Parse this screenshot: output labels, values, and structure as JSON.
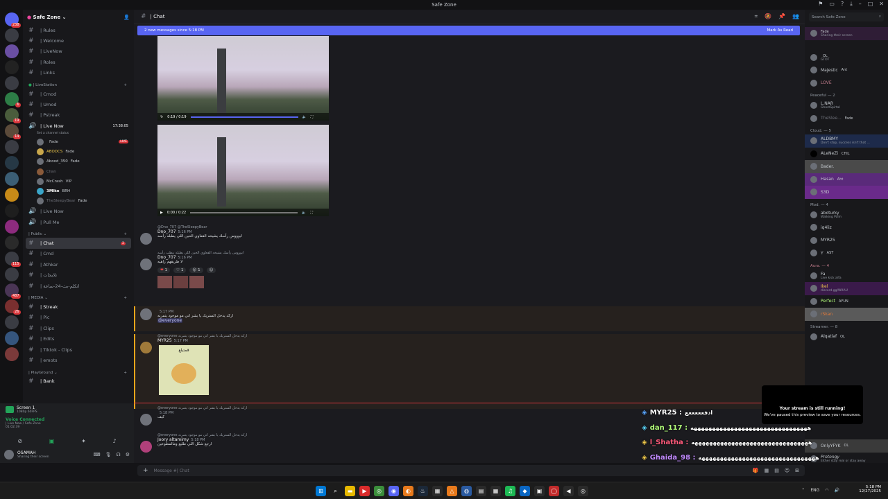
{
  "window": {
    "title": "Safe Zone"
  },
  "server": {
    "name": "Safe Zone"
  },
  "channels": {
    "top": [
      {
        "name": "| Rules"
      },
      {
        "name": "| Welcome"
      },
      {
        "name": "| LiveNow"
      },
      {
        "name": "| Roles"
      },
      {
        "name": "| Links"
      }
    ],
    "cat_live": "| LiveStation",
    "live_channels": [
      {
        "name": "| Cmod"
      },
      {
        "name": "| Umod"
      },
      {
        "name": "| Pstreak"
      }
    ],
    "voice_live": {
      "name": "| Live Now",
      "timer": "17:38:05",
      "status": "Set a channel status"
    },
    "voice_users": [
      {
        "name": "",
        "tag": "Fade",
        "live": "LIVE"
      },
      {
        "name": "ABODCS",
        "tag": "Fade"
      },
      {
        "name": "Abood_350",
        "tag": "Fade"
      },
      {
        "name": "Cllan",
        "tag": ""
      },
      {
        "name": "McCrash",
        "tag": "VIP"
      },
      {
        "name": "3Mlke",
        "tag": "BRH"
      },
      {
        "name": "TheSleepyBear",
        "tag": "Fade"
      }
    ],
    "voice_more": [
      {
        "name": "| Live Now"
      },
      {
        "name": "| Pull Me"
      }
    ],
    "cat_public": "| Public",
    "public": [
      {
        "name": "| Chat",
        "badge": "2"
      },
      {
        "name": "| Cmd"
      },
      {
        "name": "| Athkar"
      },
      {
        "name": "| تلايجات"
      },
      {
        "name": "| اتكلم-بث-24-ساعة"
      }
    ],
    "cat_media": "| MEDIA",
    "media": [
      {
        "name": "| Streak"
      },
      {
        "name": "| Pic"
      },
      {
        "name": "| Clips"
      },
      {
        "name": "| Edits"
      },
      {
        "name": "| Tiktok - Clips"
      },
      {
        "name": "| emots"
      }
    ],
    "cat_play": "| PlayGround",
    "play": [
      {
        "name": "| Bank"
      }
    ]
  },
  "userpanel": {
    "screen_title": "Screen 1",
    "screen_sub": "1080p 60FPS",
    "voice_title": "Voice Connected",
    "voice_sub": "| Live Now / Safe Zone",
    "voice_time": "01:02:39",
    "user_name": "OSAMAH",
    "user_status": "Sharing their screen"
  },
  "chat": {
    "channel": "| Chat",
    "banner": "2 new messages since 5:18 PM",
    "mark_read": "Mark As Read",
    "video1_time": "0:19 / 0:19",
    "video2_time": "0:00 / 0:22",
    "messages": [
      {
        "user": "Dno_707",
        "reply": "@Dno_707 @TheSleepyBear",
        "time": "5:16 PM",
        "text": "ابوووس رأسك يشيخه القعاوي الحين اللي يطبله رأسه"
      },
      {
        "user": "Dno_707",
        "time": "5:16 PM",
        "text": "لا طريقهم زاهيه",
        "reply": "ابوووس رأسك يشيخه القعاوي الحين اللي يطبله يبطب رأسه"
      },
      {
        "user": "",
        "time": "5:17 PM",
        "text": "اركد يدخل الستريك يا بشر اني مو موجود يتمرنه",
        "mention": "@everyone"
      },
      {
        "user": "MYR25",
        "time": "5:17 PM",
        "reply": "@everyone اركد يدخل الستريك يا بشر اني مو موجود يتمرنه",
        "sticker": "قمتبلع"
      },
      {
        "user": "",
        "time": "5:18 PM",
        "reply": "@everyone اركد يدخل الستريك يا بشر اني مو موجود يتمرنه",
        "text": "كيف"
      },
      {
        "user": "Joory altamimy",
        "time": "5:18 PM",
        "reply": "@everyone اركد يدخل الستريك يا بشر اني مو موجود يتمرنه",
        "text": "ارجع شكل اللي طليع ومالمطوعين"
      }
    ],
    "reactions": [
      {
        "icon": "❤",
        "count": "1"
      },
      {
        "icon": "♡",
        "count": "1"
      },
      {
        "icon": "😮",
        "count": "1"
      }
    ],
    "composer_placeholder": "Message #| Chat"
  },
  "overlay": {
    "rows": [
      {
        "user": "MYR25 :",
        "text": "ادفعععععع",
        "color": "#ffffff"
      },
      {
        "user": "dan_117 :",
        "text": "ههههههههههههههههههههههههههههههههه",
        "color": "#b3ff7a"
      },
      {
        "user": "l_Shatha :",
        "text": "ههههههههههههههههههههههههههههههههه",
        "color": "#ff5a7a"
      },
      {
        "user": "Ghaida_98 :",
        "text": "ههههههههههههههههههههههههههههههههه",
        "color": "#c28bff"
      }
    ],
    "notice_title": "Your stream is still running!",
    "notice_sub": "We've paused this preview to save your resources."
  },
  "members": {
    "search_placeholder": "Search Safe Zone",
    "top": [
      {
        "name": "",
        "status": "Sharing their screen",
        "tag": "Fade"
      }
    ],
    "groups": [
      {
        "label": "",
        "items": [
          {
            "name": "",
            "tag": "OL",
            "sub": "GTOT"
          },
          {
            "name": "Majestic",
            "tag": "Ant"
          },
          {
            "name": "LOVE",
            "tag": ""
          }
        ]
      },
      {
        "label": "Peaceful — 2",
        "items": [
          {
            "name": "L.NAR",
            "sub": "GhostSpirtal"
          },
          {
            "name": "TheSlee...",
            "tag": "Fade"
          }
        ]
      },
      {
        "label": "Cloud. — 5",
        "items": [
          {
            "name": "ALDBMY",
            "sub": "Don't stop, success isn't that ..."
          },
          {
            "name": "ALeNeZi",
            "tag": "CHIL"
          },
          {
            "name": "Bader.",
            "tag": ""
          },
          {
            "name": "Hasan",
            "tag": "Aht"
          },
          {
            "name": "S3D",
            "tag": ""
          }
        ]
      },
      {
        "label": "Mod. — 4",
        "items": [
          {
            "name": "aboturky",
            "sub": "Walking Palm"
          },
          {
            "name": "iq4liz",
            "tag": ""
          },
          {
            "name": "MYR25",
            "tag": ""
          },
          {
            "name": "Y",
            "tag": "AST"
          }
        ]
      },
      {
        "label": "Aura. — 4",
        "items": [
          {
            "name": "Fa",
            "sub": "Live kick a/fa"
          },
          {
            "name": "Ikel",
            "sub": "discord.gg/WXAU"
          },
          {
            "name": "Perfect",
            "tag": "AFUN"
          },
          {
            "name": "rSkan",
            "tag": ""
          }
        ]
      },
      {
        "label": "Streamer. — 8",
        "items": [
          {
            "name": "Alqatlaf",
            "tag": "OL"
          }
        ]
      }
    ],
    "bottom": [
      {
        "name": "OnlyYFYK",
        "tag": "OL"
      },
      {
        "name": "Protongy",
        "sub": "Either stay real or stay away"
      }
    ]
  },
  "taskbar": {
    "lang": "ENG",
    "time": "5:18 PM",
    "date": "12/27/2025"
  },
  "colors": {
    "accent": "#5865f2",
    "live": "#da373c",
    "online": "#23a55a"
  }
}
